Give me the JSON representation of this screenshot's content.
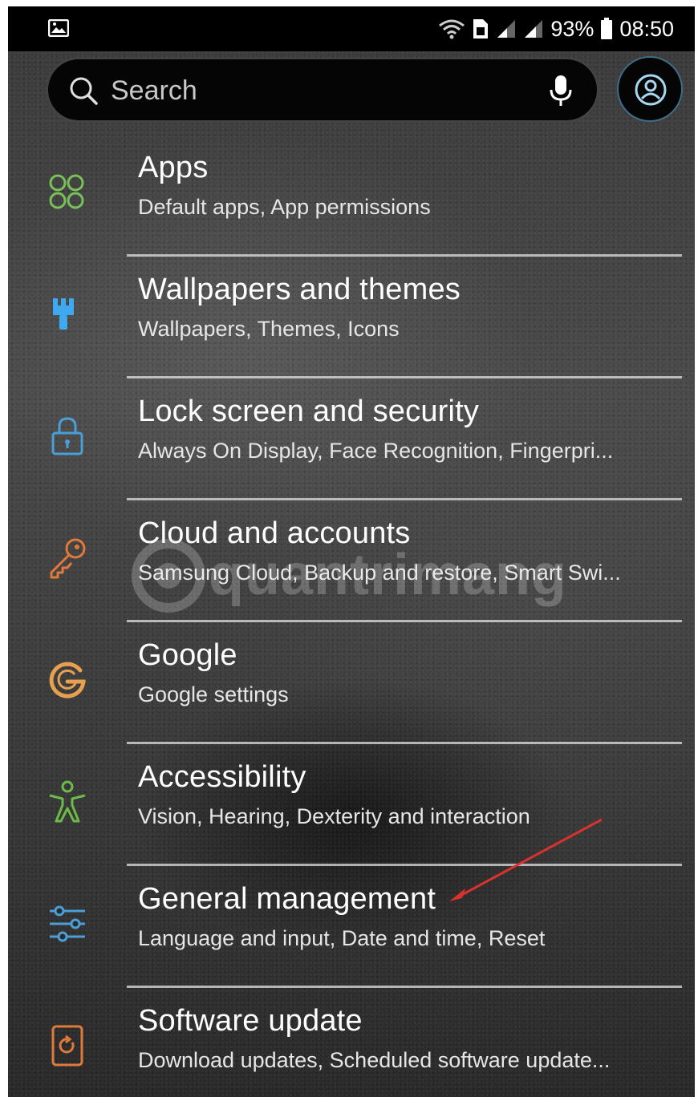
{
  "status_bar": {
    "battery": "93%",
    "time": "08:50"
  },
  "search": {
    "placeholder": "Search"
  },
  "settings": [
    {
      "title": "Apps",
      "subtitle": "Default apps, App permissions",
      "icon": "apps-icon",
      "color": "#7ac05a"
    },
    {
      "title": "Wallpapers and themes",
      "subtitle": "Wallpapers, Themes, Icons",
      "icon": "paintbrush-icon",
      "color": "#3ea8f0"
    },
    {
      "title": "Lock screen and security",
      "subtitle": "Always On Display, Face Recognition, Fingerpri...",
      "icon": "lock-icon",
      "color": "#4a9fd8"
    },
    {
      "title": "Cloud and accounts",
      "subtitle": "Samsung Cloud, Backup and restore, Smart Swi...",
      "icon": "key-icon",
      "color": "#e07a3a"
    },
    {
      "title": "Google",
      "subtitle": "Google settings",
      "icon": "google-icon",
      "color": "#e8a050"
    },
    {
      "title": "Accessibility",
      "subtitle": "Vision, Hearing, Dexterity and interaction",
      "icon": "accessibility-icon",
      "color": "#6dba48"
    },
    {
      "title": "General management",
      "subtitle": "Language and input, Date and time, Reset",
      "icon": "sliders-icon",
      "color": "#4a9fd8"
    },
    {
      "title": "Software update",
      "subtitle": "Download updates, Scheduled software update...",
      "icon": "software-update-icon",
      "color": "#e07a3a"
    }
  ],
  "watermark": "quantrimang"
}
